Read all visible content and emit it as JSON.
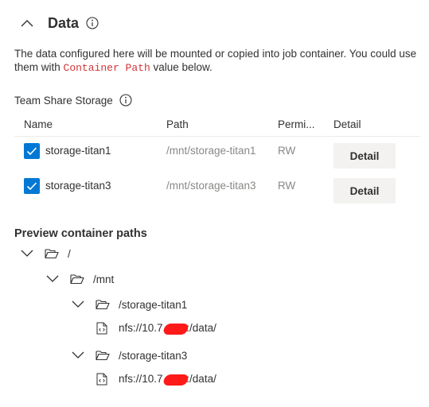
{
  "section": {
    "title": "Data",
    "description_part1": "The data configured here will be mounted or copied into job container. You could use them with ",
    "description_code": "Container Path",
    "description_part2": " value below."
  },
  "team_share": {
    "label": "Team Share Storage",
    "columns": {
      "name": "Name",
      "path": "Path",
      "permission": "Permi...",
      "detail": "Detail"
    },
    "rows": [
      {
        "name": "storage-titan1",
        "path": "/mnt/storage-titan1",
        "permission": "RW",
        "detail_label": "Detail",
        "checked": true
      },
      {
        "name": "storage-titan3",
        "path": "/mnt/storage-titan3",
        "permission": "RW",
        "detail_label": "Detail",
        "checked": true
      }
    ]
  },
  "preview": {
    "title": "Preview container paths",
    "tree": {
      "root": "/",
      "mnt": "/mnt",
      "storage1": "/storage-titan1",
      "storage1_file_prefix": "nfs://10.7.",
      "storage1_file_suffix": ":/data/",
      "storage3": "/storage-titan3",
      "storage3_file_prefix": "nfs://10.7.",
      "storage3_file_suffix": ":/data/"
    }
  },
  "colors": {
    "accent": "#0078d4",
    "code": "#d13438",
    "muted": "#8a8886",
    "redaction": "#ff1a1a"
  },
  "icons": {
    "collapse": "chevron-up-icon",
    "info": "info-icon",
    "checkbox": "checkmark-icon",
    "expand": "chevron-down-icon",
    "folder": "folder-open-icon",
    "file": "code-file-icon"
  }
}
